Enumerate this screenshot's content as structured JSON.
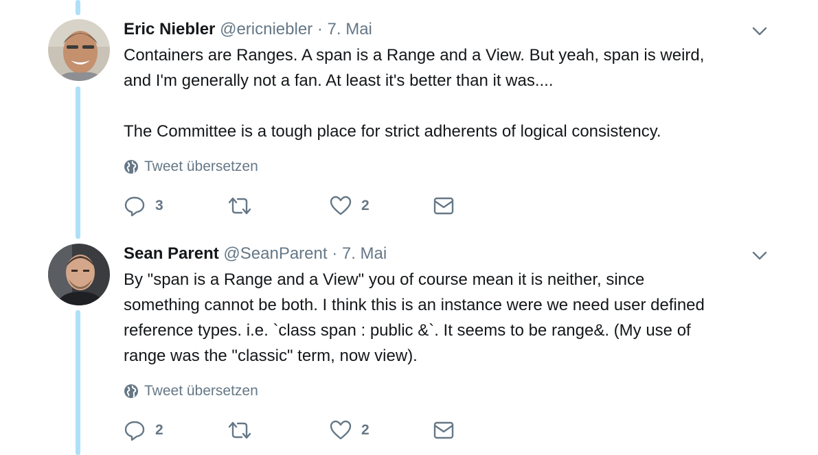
{
  "colors": {
    "thread_line": "#aee0f7",
    "name": "#14171a",
    "secondary": "#657786"
  },
  "tweets": [
    {
      "fullname": "Eric Niebler",
      "username": "@ericniebler",
      "separator": "·",
      "timestamp": "7. Mai",
      "avatar_icon": "avatar-eric-niebler",
      "text_lines": [
        "Containers are Ranges. A span is a Range and a View. But yeah, span is weird,",
        "and I'm generally not a fan. At least it's better than it was....",
        "",
        "The Committee is a tough place for strict adherents of logical consistency."
      ],
      "translate_label": "Tweet übersetzen",
      "reply_count": "3",
      "retweet_count": "",
      "like_count": "2"
    },
    {
      "fullname": "Sean Parent",
      "username": "@SeanParent",
      "separator": "·",
      "timestamp": "7. Mai",
      "avatar_icon": "avatar-sean-parent",
      "text_lines": [
        "By \"span is a Range and a View\" you of course mean it is neither, since",
        "something cannot be both. I think this is an instance were we need user defined",
        "reference types. i.e. `class span : public &`. It seems to be range&. (My use of",
        "range was the \"classic\" term, now view)."
      ],
      "translate_label": "Tweet übersetzen",
      "reply_count": "2",
      "retweet_count": "",
      "like_count": "2"
    }
  ]
}
